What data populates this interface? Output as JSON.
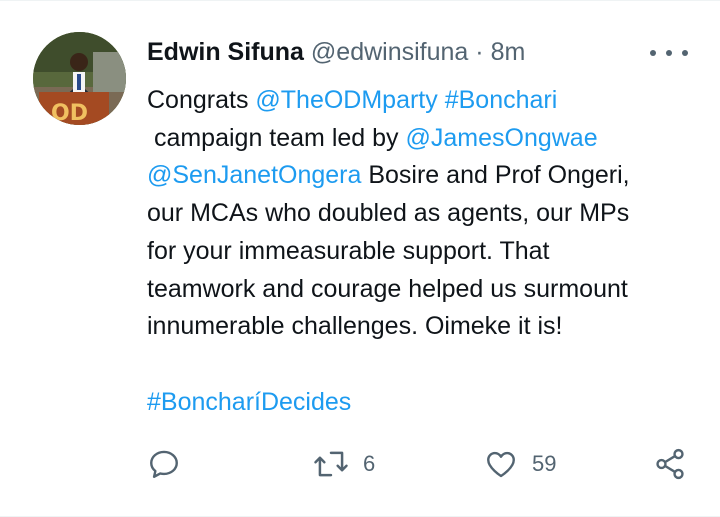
{
  "author": {
    "name": "Edwin Sifuna",
    "handle": "@edwinsifuna",
    "separator": "·",
    "time": "8m"
  },
  "tweet": {
    "lines": [
      [
        {
          "t": "Congrats ",
          "c": "text"
        },
        {
          "t": "@TheODMparty",
          "c": "link"
        },
        {
          "t": " ",
          "c": "text"
        },
        {
          "t": "#Bonchari",
          "c": "link"
        }
      ],
      [
        {
          "t": " campaign team led by ",
          "c": "text"
        },
        {
          "t": "@JamesOngwae",
          "c": "link"
        }
      ],
      [
        {
          "t": "@SenJanetOngera",
          "c": "link"
        },
        {
          "t": " Bosire and Prof Ongeri,",
          "c": "text"
        }
      ],
      [
        {
          "t": "our MCAs who doubled as agents, our MPs",
          "c": "text"
        }
      ],
      [
        {
          "t": "for your immeasurable support. That",
          "c": "text"
        }
      ],
      [
        {
          "t": "teamwork and courage helped us surmount",
          "c": "text"
        }
      ],
      [
        {
          "t": "innumerable challenges. Oimeke it is!",
          "c": "text"
        }
      ],
      [
        {
          "t": " ",
          "c": "text"
        }
      ],
      [
        {
          "t": "#BoncharíDecides",
          "c": "link"
        }
      ]
    ]
  },
  "actions": {
    "reply_icon": "reply-icon",
    "retweet_icon": "retweet-icon",
    "retweet_count": "6",
    "like_icon": "heart-icon",
    "like_count": "59",
    "share_icon": "share-icon"
  },
  "colors": {
    "link": "#1d9bf0",
    "secondary": "#536471",
    "text": "#0f1419"
  }
}
